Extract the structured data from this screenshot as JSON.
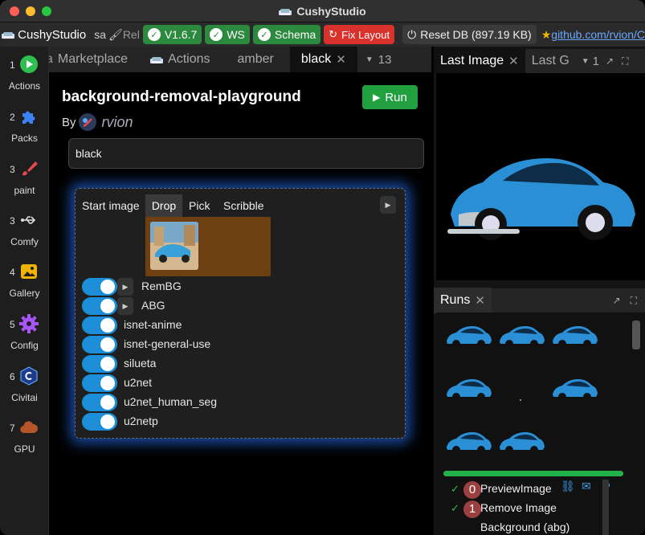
{
  "window": {
    "title": "CushyStudio"
  },
  "appbar": {
    "app_name": "CushyStudio",
    "truncated_1": "sa",
    "truncated_2": "Rel",
    "version": "V1.6.7",
    "ws": "WS",
    "schema": "Schema",
    "fix_layout": "Fix Layout",
    "reset_db": "Reset DB (897.19 KB)",
    "github": "github.com/rvion/C"
  },
  "sidebar": {
    "items": [
      {
        "num": "1",
        "label": "Actions",
        "icon": "play-icon"
      },
      {
        "num": "2",
        "label": "Packs",
        "icon": "puzzle-icon"
      },
      {
        "num": "3",
        "label": "paint",
        "icon": "brush-icon"
      },
      {
        "num": "3",
        "label": "Comfy",
        "icon": "usb-icon"
      },
      {
        "num": "4",
        "label": "Gallery",
        "icon": "image-icon"
      },
      {
        "num": "5",
        "label": "Config",
        "icon": "gear-icon"
      },
      {
        "num": "6",
        "label": "Civitai",
        "icon": "civitai-icon"
      },
      {
        "num": "7",
        "label": "GPU",
        "icon": "cloud-icon"
      }
    ]
  },
  "center_tabs": {
    "items": [
      "Marketplace",
      "Actions",
      "amber",
      "black"
    ],
    "active": "black",
    "count": "13"
  },
  "draft": {
    "title": "background-removal-playground",
    "by": "By",
    "author": "rvion",
    "run_label": "Run",
    "draft_name": "black",
    "start_image_label": "Start image",
    "image_tabs": [
      "Drop",
      "Pick",
      "Scribble"
    ],
    "active_image_tab": "Drop",
    "options": [
      {
        "label": "RemBG",
        "expandable": true
      },
      {
        "label": "ABG",
        "expandable": true
      },
      {
        "label": "isnet-anime",
        "expandable": false
      },
      {
        "label": "isnet-general-use",
        "expandable": false
      },
      {
        "label": "silueta",
        "expandable": false
      },
      {
        "label": "u2net",
        "expandable": false
      },
      {
        "label": "u2net_human_seg",
        "expandable": false
      },
      {
        "label": "u2netp",
        "expandable": false
      }
    ]
  },
  "right_top": {
    "tabs": [
      "Last Image",
      "Last G"
    ],
    "count": "1"
  },
  "runs": {
    "tab": "Runs",
    "progress": 1.0,
    "steps": [
      {
        "index": "0",
        "label": "PreviewImage"
      },
      {
        "index": "1",
        "label": "Remove Image"
      },
      {
        "index": "",
        "label": "Background (abg)"
      }
    ]
  },
  "colors": {
    "accent_blue": "#1d8fd8",
    "run_green": "#22a03f",
    "fix_red": "#d9312b",
    "drop_brown": "#6e3f10",
    "step_badge": "#9a4040"
  }
}
